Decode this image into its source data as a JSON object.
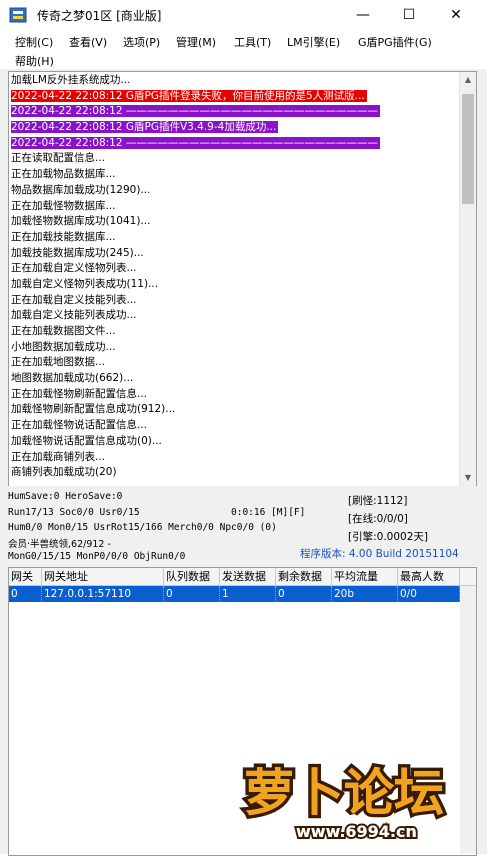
{
  "window": {
    "title": "传奇之梦01区 [商业版]",
    "minimize": "—",
    "maximize": "☐",
    "close": "✕"
  },
  "menu": {
    "items": [
      "控制(C)",
      "查看(V)",
      "选项(P)",
      "管理(M)",
      "工具(T)",
      "LM引擎(E)",
      "G盾PG插件(G)",
      "帮助(H)"
    ]
  },
  "log": {
    "lines": [
      {
        "text": "加载LM反外挂系统成功...",
        "bg": "",
        "fg": "#000000"
      },
      {
        "text": "2022-04-22 22:08:12 G盾PG插件登录失败，你目前使用的是5人测试版...",
        "bg": "#e60000",
        "fg": "#ffffff"
      },
      {
        "text": "2022-04-22 22:08:12 ————————————————————————",
        "bg": "#8a12c8",
        "fg": "#ffffff"
      },
      {
        "text": "2022-04-22 22:08:12 G盾PG插件V3.4.9-4加载成功...",
        "bg": "#8a12c8",
        "fg": "#ffffff"
      },
      {
        "text": "2022-04-22 22:08:12 ————————————————————————",
        "bg": "#8a12c8",
        "fg": "#ffffff"
      },
      {
        "text": "正在读取配置信息...",
        "bg": "",
        "fg": "#000000"
      },
      {
        "text": "正在加载物品数据库...",
        "bg": "",
        "fg": "#000000"
      },
      {
        "text": "物品数据库加载成功(1290)...",
        "bg": "",
        "fg": "#000000"
      },
      {
        "text": "正在加载怪物数据库...",
        "bg": "",
        "fg": "#000000"
      },
      {
        "text": "加载怪物数据库成功(1041)...",
        "bg": "",
        "fg": "#000000"
      },
      {
        "text": "正在加载技能数据库...",
        "bg": "",
        "fg": "#000000"
      },
      {
        "text": "加载技能数据库成功(245)...",
        "bg": "",
        "fg": "#000000"
      },
      {
        "text": "正在加载自定义怪物列表...",
        "bg": "",
        "fg": "#000000"
      },
      {
        "text": "加载自定义怪物列表成功(11)...",
        "bg": "",
        "fg": "#000000"
      },
      {
        "text": "正在加载自定义技能列表...",
        "bg": "",
        "fg": "#000000"
      },
      {
        "text": "加载自定义技能列表成功...",
        "bg": "",
        "fg": "#000000"
      },
      {
        "text": "正在加载数据图文件...",
        "bg": "",
        "fg": "#000000"
      },
      {
        "text": "小地图数据加载成功...",
        "bg": "",
        "fg": "#000000"
      },
      {
        "text": "正在加载地图数据...",
        "bg": "",
        "fg": "#000000"
      },
      {
        "text": "地图数据加载成功(662)...",
        "bg": "",
        "fg": "#000000"
      },
      {
        "text": "正在加载怪物刷新配置信息...",
        "bg": "",
        "fg": "#000000"
      },
      {
        "text": "加载怪物刷新配置信息成功(912)...",
        "bg": "",
        "fg": "#000000"
      },
      {
        "text": "正在加载怪物说话配置信息...",
        "bg": "",
        "fg": "#000000"
      },
      {
        "text": "加载怪物说话配置信息成功(0)...",
        "bg": "",
        "fg": "#000000"
      },
      {
        "text": "正在加载商铺列表...",
        "bg": "",
        "fg": "#000000"
      },
      {
        "text": "商铺列表加载成功(20)",
        "bg": "",
        "fg": "#000000"
      }
    ]
  },
  "status": {
    "line1": "HumSave:0 HeroSave:0",
    "line2": "Run17/13 Soc0/0 Usr0/15",
    "time": "0:0:16 [M][F]",
    "line3": "Hum0/0 Mon0/15 UsrRot15/166 Merch0/0 Npc0/0 (0)",
    "line4": "会员·半兽统领,62/912 -",
    "line5": "MonG0/15/15 MonP0/0/0 ObjRun0/0",
    "refresh": "[刷怪:1112]",
    "online": "[在线:0/0/0]",
    "engine": "[引擎:0.0002天]",
    "version": "程序版本: 4.00 Build 20151104"
  },
  "gate_table": {
    "headers": [
      "网关",
      "网关地址",
      "队列数据",
      "发送数据",
      "剩余数据",
      "平均流量",
      "最高人数"
    ],
    "rows": [
      [
        "0",
        "127.0.0.1:57110",
        "0",
        "1",
        "0",
        "20b",
        "0/0"
      ]
    ]
  },
  "watermark": {
    "brand": "萝卜论坛",
    "url": "www.6994.cn"
  },
  "colors": {
    "error_bg": "#e60000",
    "plugin_bg": "#8a12c8",
    "selected_row": "#0a5fd0",
    "version_text": "#1a4fc0"
  }
}
